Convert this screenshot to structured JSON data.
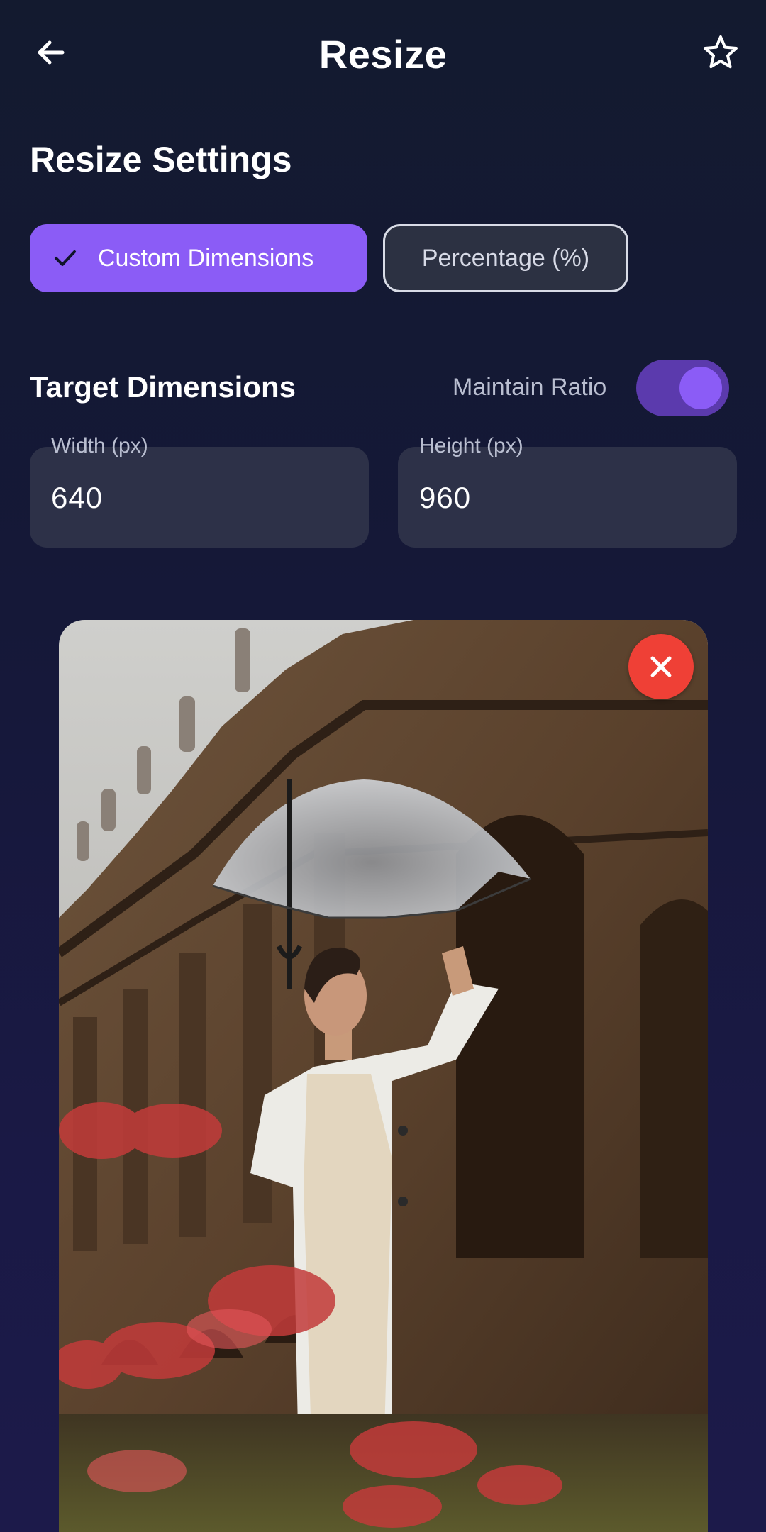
{
  "header": {
    "title": "Resize",
    "back_icon": "arrow-left-icon",
    "favorite_icon": "star-outline-icon"
  },
  "settings": {
    "section_title": "Resize Settings",
    "modes": [
      {
        "label": "Custom Dimensions",
        "selected": true
      },
      {
        "label": "Percentage (%)",
        "selected": false
      }
    ]
  },
  "dimensions": {
    "title": "Target Dimensions",
    "maintain_ratio_label": "Maintain Ratio",
    "maintain_ratio_on": true,
    "width_label": "Width (px)",
    "width_value": "640",
    "height_label": "Height (px)",
    "height_value": "960"
  },
  "preview": {
    "remove_icon": "close-icon"
  },
  "colors": {
    "accent": "#8b5cf6",
    "remove": "#ef4036",
    "background": "#151838"
  }
}
